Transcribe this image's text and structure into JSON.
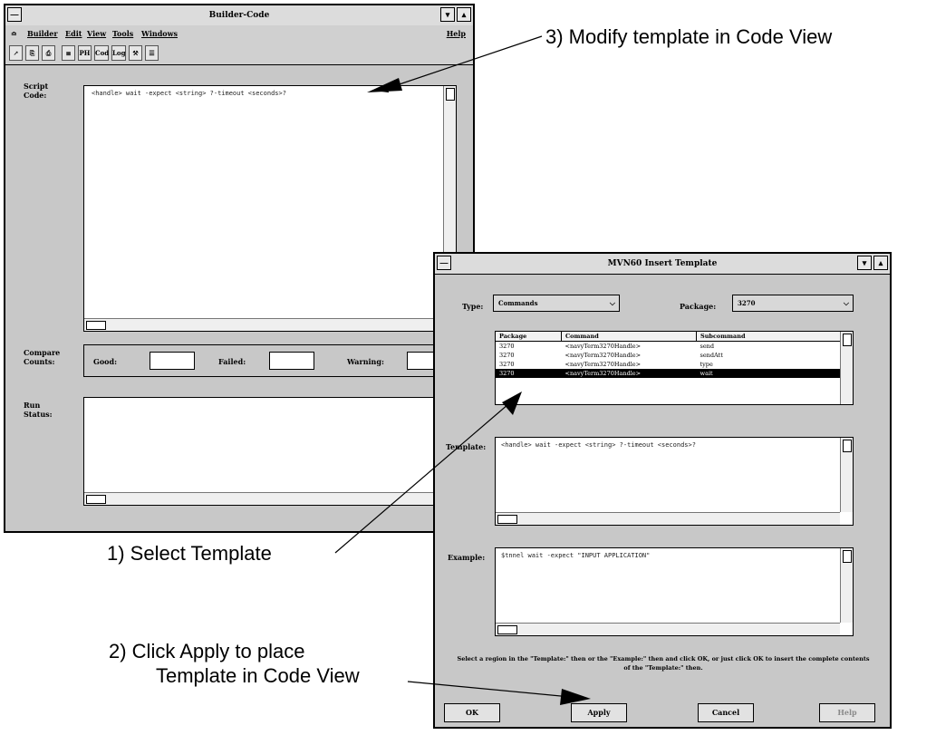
{
  "builder": {
    "title": "Builder-Code",
    "menu": [
      "Builder",
      "Edit",
      "View",
      "Tools",
      "Windows",
      "Help"
    ],
    "toolbar": [
      "↗",
      "⎘",
      "⎙",
      "≣",
      "PH",
      "Cod",
      "Log",
      "⚒",
      "☰"
    ],
    "script_label": "Script Code:",
    "script_text": "<handle> wait -expect <string> ?-timeout <seconds>?",
    "compare_label": "Compare Counts:",
    "good_label": "Good:",
    "failed_label": "Failed:",
    "warning_label": "Warning:",
    "run_label": "Run Status:"
  },
  "dialog": {
    "title": "MVN60 Insert Template",
    "type_label": "Type:",
    "type_value": "Commands",
    "package_label": "Package:",
    "package_value": "3270",
    "columns": [
      "Package",
      "Command",
      "Subcommand"
    ],
    "rows": [
      [
        "3270",
        "<navyTerm3270Handle>",
        "send"
      ],
      [
        "3270",
        "<navyTerm3270Handle>",
        "sendAtt"
      ],
      [
        "3270",
        "<navyTerm3270Handle>",
        "type"
      ],
      [
        "3270",
        "<navyTerm3270Handle>",
        "wait"
      ]
    ],
    "selected_row": 3,
    "template_label": "Template:",
    "template_text": "<handle> wait -expect <string> ?-timeout <seconds>?",
    "example_label": "Example:",
    "example_text": "$tnnel wait -expect \"INPUT APPLICATION\"",
    "instruction": "Select a region in the \"Template:\" then or the \"Example:\" then and click OK, or just click OK to insert the complete contents of the \"Template:\" then.",
    "buttons": {
      "ok": "OK",
      "apply": "Apply",
      "cancel": "Cancel",
      "help": "Help"
    }
  },
  "callouts": {
    "step1": "1) Select Template",
    "step2a": "2) Click Apply to place",
    "step2b": "Template in Code View",
    "step3": "3) Modify template in Code View"
  }
}
